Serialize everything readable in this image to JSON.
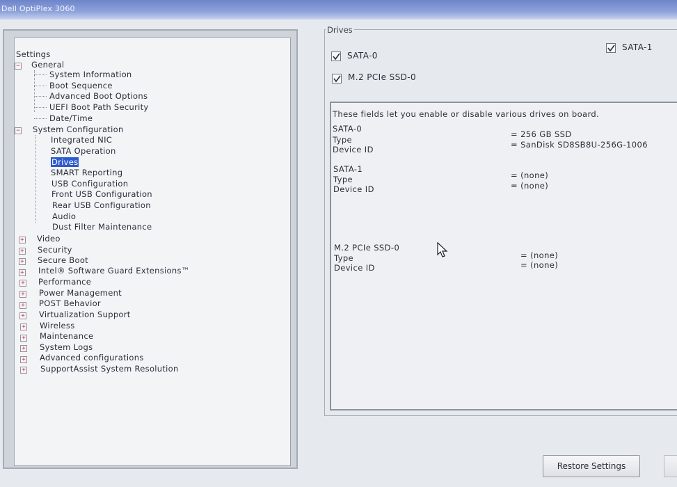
{
  "window": {
    "title": "Dell OptiPlex 3060"
  },
  "tree": {
    "root": "Settings",
    "general": {
      "label": "General",
      "children": [
        "System Information",
        "Boot Sequence",
        "Advanced Boot Options",
        "UEFI Boot Path Security",
        "Date/Time"
      ]
    },
    "system_configuration": {
      "label": "System Configuration",
      "children": [
        "Integrated NIC",
        "SATA Operation",
        "Drives",
        "SMART Reporting",
        "USB Configuration",
        "Front USB Configuration",
        "Rear USB Configuration",
        "Audio",
        "Dust Filter Maintenance"
      ],
      "selected": "Drives"
    },
    "collapsed": [
      "Video",
      "Security",
      "Secure Boot",
      "Intel® Software Guard Extensions™",
      "Performance",
      "Power Management",
      "POST Behavior",
      "Virtualization Support",
      "Wireless",
      "Maintenance",
      "System Logs",
      "Advanced configurations",
      "SupportAssist System Resolution"
    ]
  },
  "drives": {
    "legend": "Drives",
    "checkboxes": [
      {
        "label": "SATA-0",
        "checked": true
      },
      {
        "label": "SATA-1",
        "checked": true
      },
      {
        "label": "M.2 PCIe SSD-0",
        "checked": true
      }
    ],
    "info": {
      "description": "These fields let you enable or disable various drives on board.",
      "sections": [
        {
          "name": "SATA-0",
          "type_label": "Type",
          "type_value": "= 256 GB SSD",
          "id_label": "Device ID",
          "id_value": "= SanDisk SD8SB8U-256G-1006"
        },
        {
          "name": "SATA-1",
          "type_label": "Type",
          "type_value": "= (none)",
          "id_label": "Device ID",
          "id_value": "= (none)"
        },
        {
          "name": "M.2 PCIe SSD-0",
          "type_label": "Type",
          "type_value": "= (none)",
          "id_label": "Device ID",
          "id_value": "= (none)"
        }
      ]
    }
  },
  "buttons": {
    "restore": "Restore Settings"
  },
  "colors": {
    "selection": "#2f5ccc",
    "titlebar": "#7c93d2"
  }
}
